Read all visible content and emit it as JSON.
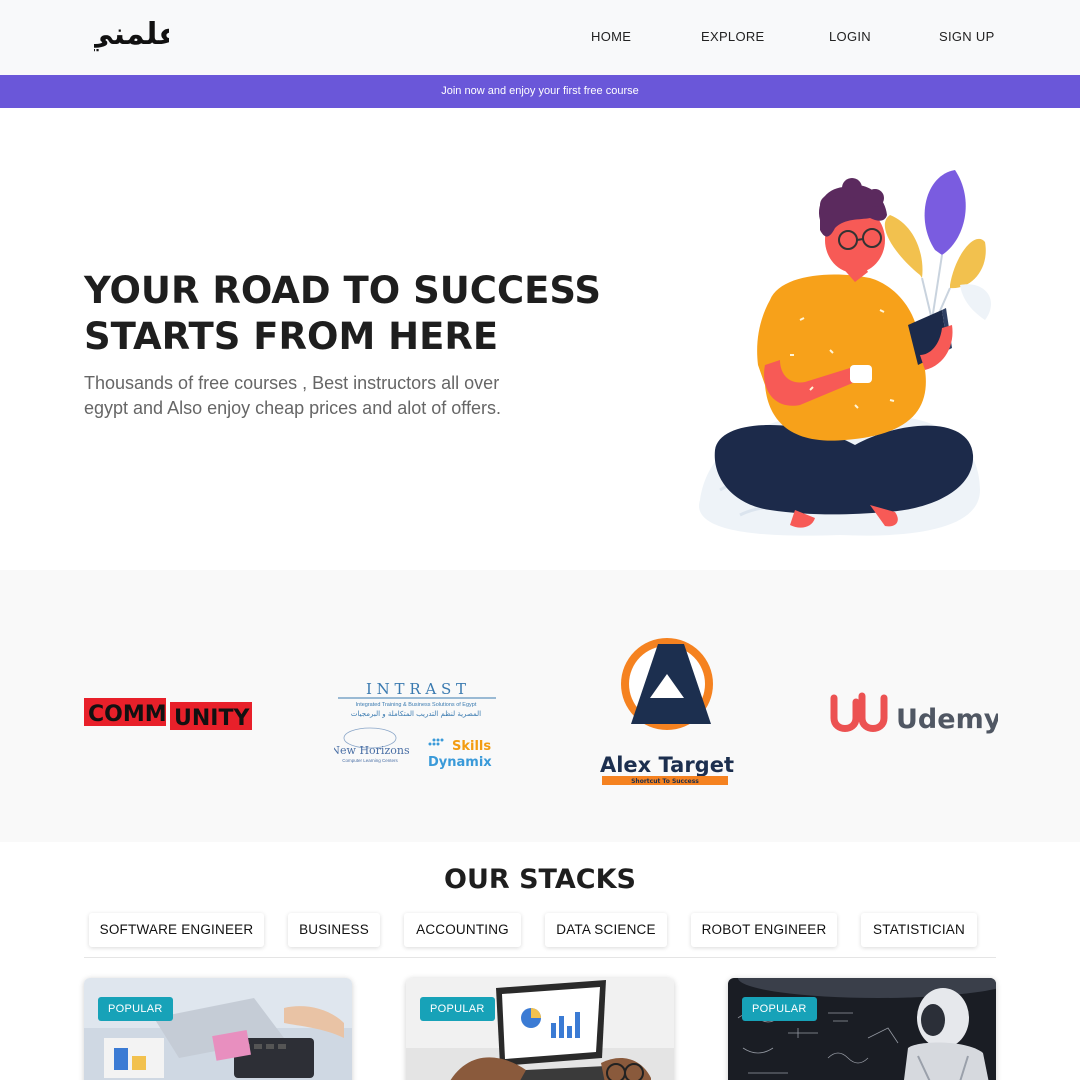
{
  "header": {
    "logo_text": "علمني",
    "nav": [
      "HOME",
      "EXPLORE",
      "LOGIN",
      "SIGN UP"
    ]
  },
  "banner": {
    "text": "Join now and enjoy your first free course"
  },
  "hero": {
    "title_line1": "YOUR ROAD TO SUCCESS",
    "title_line2": "STARTS FROM HERE",
    "subtitle": "Thousands of free courses , Best instructors all over egypt and Also enjoy cheap prices and alot of offers."
  },
  "partners": {
    "community": {
      "left": "COMM",
      "right": "UNITY"
    },
    "intrast": {
      "name": "I N T R A S T",
      "line1": "Integrated Training & Business Solutions of Egypt",
      "line2": "المصرية لنظم التدريب المتكاملة و البرمجيات",
      "nh": "New Horizons",
      "nh_sub": "Computer Learning Centers",
      "skills": "Skills",
      "dynamix": "Dynamix"
    },
    "alex": {
      "name": "Alex Target",
      "tagline": "Shortcut To Success"
    },
    "udemy": {
      "name": "Udemy"
    }
  },
  "stacks": {
    "title": "OUR STACKS",
    "tabs": [
      "SOFTWARE ENGINEER",
      "BUSINESS",
      "ACCOUNTING",
      "DATA SCIENCE",
      "ROBOT ENGINEER",
      "STATISTICIAN"
    ],
    "cards": [
      {
        "badge": "POPULAR"
      },
      {
        "badge": "POPULAR"
      },
      {
        "badge": "POPULAR"
      }
    ]
  },
  "colors": {
    "banner": "#6a57d9",
    "badge": "#17a2b8",
    "accent_orange": "#f7a11a"
  }
}
